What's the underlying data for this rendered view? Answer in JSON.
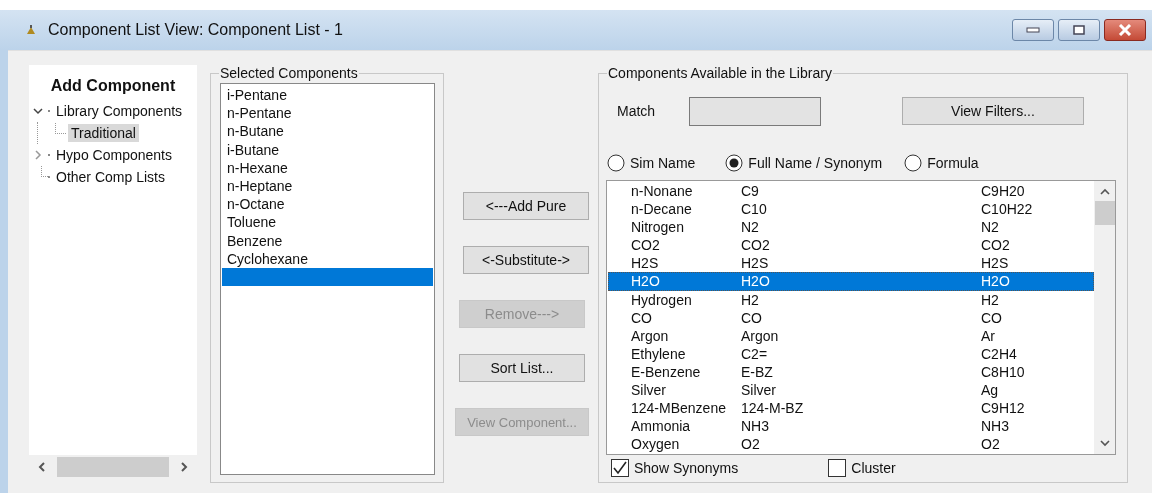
{
  "window": {
    "title": "Component List View: Component List - 1"
  },
  "add_component": {
    "title": "Add Component",
    "tree": [
      {
        "label": "Library Components",
        "expanded": true,
        "selected": false,
        "children": [
          {
            "label": "Traditional",
            "selected": true
          }
        ]
      },
      {
        "label": "Hypo Components",
        "expanded": false,
        "selected": false
      },
      {
        "label": "Other Comp Lists",
        "selected": false
      }
    ]
  },
  "selected_components": {
    "title": "Selected Components",
    "items": [
      {
        "label": "i-Pentane",
        "selected": false
      },
      {
        "label": "n-Pentane",
        "selected": false
      },
      {
        "label": "n-Butane",
        "selected": false
      },
      {
        "label": "i-Butane",
        "selected": false
      },
      {
        "label": "n-Hexane",
        "selected": false
      },
      {
        "label": "n-Heptane",
        "selected": false
      },
      {
        "label": "n-Octane",
        "selected": false
      },
      {
        "label": "Toluene",
        "selected": false
      },
      {
        "label": "Benzene",
        "selected": false
      },
      {
        "label": "Cyclohexane",
        "selected": false
      }
    ],
    "blank_row_selected": true
  },
  "buttons": [
    {
      "label": "<---Add Pure",
      "disabled": false
    },
    {
      "label": "<-Substitute->",
      "disabled": false
    },
    {
      "label": "Remove--->",
      "disabled": true
    },
    {
      "label": "Sort List...",
      "disabled": false
    },
    {
      "label": "View Component...",
      "disabled": true
    }
  ],
  "library": {
    "title": "Components Available in the Library",
    "match_label": "Match",
    "view_filters": "View Filters...",
    "radios": [
      {
        "label": "Sim Name",
        "selected": false
      },
      {
        "label": "Full Name / Synonym",
        "selected": true
      },
      {
        "label": "Formula",
        "selected": false
      }
    ],
    "rows": [
      {
        "name": "n-Nonane",
        "sim_name": "C9",
        "formula": "C9H20",
        "selected": false
      },
      {
        "name": "n-Decane",
        "sim_name": "C10",
        "formula": "C10H22",
        "selected": false
      },
      {
        "name": "Nitrogen",
        "sim_name": "N2",
        "formula": "N2",
        "selected": false
      },
      {
        "name": "CO2",
        "sim_name": "CO2",
        "formula": "CO2",
        "selected": false
      },
      {
        "name": "H2S",
        "sim_name": "H2S",
        "formula": "H2S",
        "selected": false
      },
      {
        "name": "H2O",
        "sim_name": "H2O",
        "formula": "H2O",
        "selected": true
      },
      {
        "name": "Hydrogen",
        "sim_name": "H2",
        "formula": "H2",
        "selected": false
      },
      {
        "name": "CO",
        "sim_name": "CO",
        "formula": "CO",
        "selected": false
      },
      {
        "name": "Argon",
        "sim_name": "Argon",
        "formula": "Ar",
        "selected": false
      },
      {
        "name": "Ethylene",
        "sim_name": "C2=",
        "formula": "C2H4",
        "selected": false
      },
      {
        "name": "E-Benzene",
        "sim_name": "E-BZ",
        "formula": "C8H10",
        "selected": false
      },
      {
        "name": "Silver",
        "sim_name": "Silver",
        "formula": "Ag",
        "selected": false
      },
      {
        "name": "124-MBenzene",
        "sim_name": "124-M-BZ",
        "formula": "C9H12",
        "selected": false
      },
      {
        "name": "Ammonia",
        "sim_name": "NH3",
        "formula": "NH3",
        "selected": false
      },
      {
        "name": "Oxygen",
        "sim_name": "O2",
        "formula": "O2",
        "selected": false
      }
    ],
    "checkboxes": [
      {
        "label": "Show Synonyms",
        "checked": true
      },
      {
        "label": "Cluster",
        "checked": false
      }
    ]
  }
}
